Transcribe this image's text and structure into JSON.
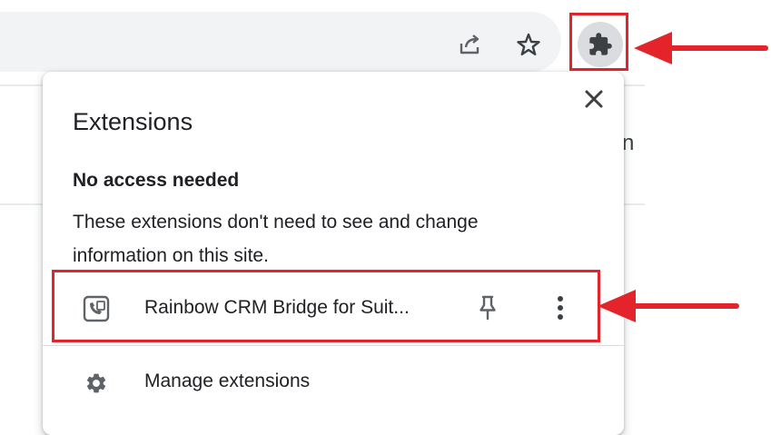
{
  "toolbar": {
    "share_icon": "share-icon",
    "bookmark_icon": "star-icon",
    "extensions_icon": "puzzle-icon"
  },
  "background": {
    "partial_text": "n"
  },
  "popup": {
    "title": "Extensions",
    "close_icon": "close-icon",
    "section_heading": "No access needed",
    "section_description": "These extensions don't need to see and change information on this site.",
    "extensions": [
      {
        "name": "Rainbow CRM Bridge for Suit...",
        "icon": "phone-card-icon",
        "pin_icon": "pin-icon",
        "menu_icon": "more-vert-icon"
      }
    ],
    "manage_label": "Manage extensions",
    "manage_icon": "gear-icon"
  },
  "annotations": {
    "highlight_color": "#e3242b"
  }
}
